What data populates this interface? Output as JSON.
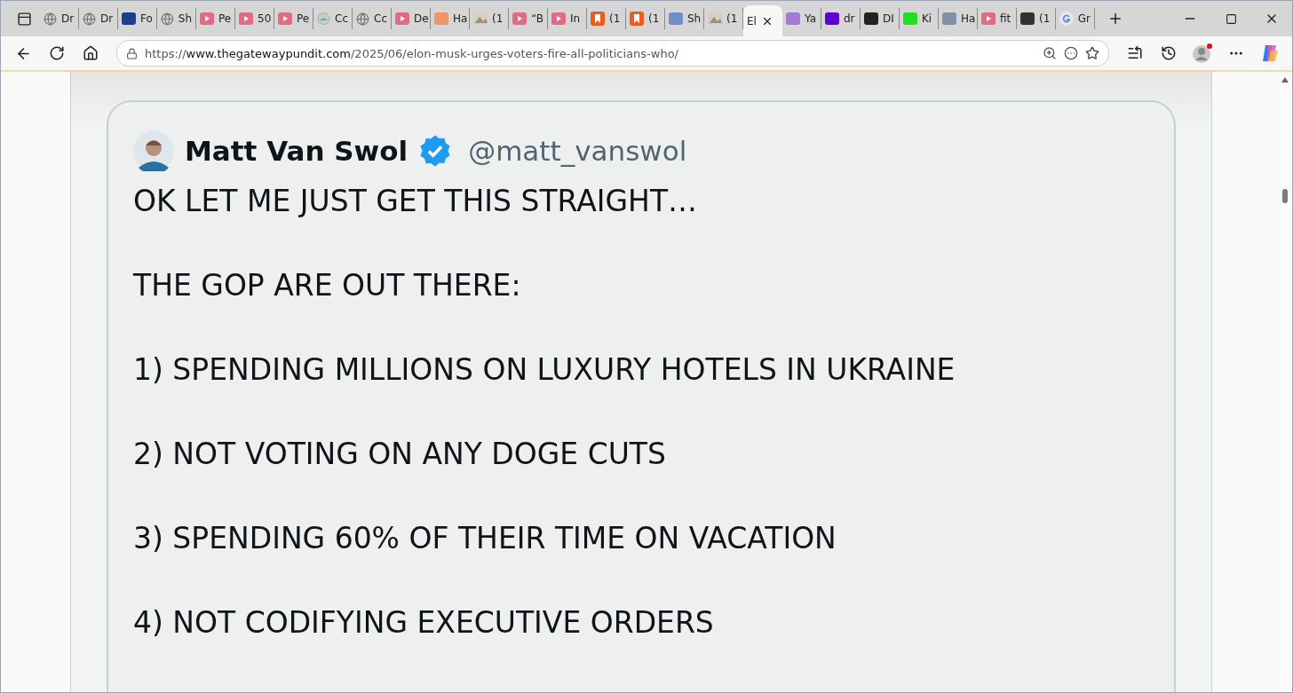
{
  "tabs": [
    {
      "label": "Dr",
      "kind": "globe",
      "selected": false
    },
    {
      "label": "Dr",
      "kind": "globe",
      "selected": false
    },
    {
      "label": "Fo",
      "kind": "logo",
      "color": "#1b3f8f",
      "selected": false
    },
    {
      "label": "Sh",
      "kind": "globe",
      "selected": false
    },
    {
      "label": "Pe",
      "kind": "video",
      "selected": false
    },
    {
      "label": "50",
      "kind": "video",
      "selected": false
    },
    {
      "label": "Pe",
      "kind": "video",
      "selected": false
    },
    {
      "label": "Cc",
      "kind": "seal",
      "selected": false
    },
    {
      "label": "Cc",
      "kind": "globe",
      "selected": false
    },
    {
      "label": "De",
      "kind": "video",
      "selected": false
    },
    {
      "label": "Ha",
      "kind": "logo",
      "color": "#f0946a",
      "selected": false
    },
    {
      "label": "(1",
      "kind": "photo",
      "selected": false
    },
    {
      "label": "“B",
      "kind": "video",
      "selected": false
    },
    {
      "label": "In",
      "kind": "video",
      "selected": false
    },
    {
      "label": "(1",
      "kind": "bookmark",
      "selected": false
    },
    {
      "label": "(1",
      "kind": "bookmark",
      "selected": false
    },
    {
      "label": "Sh",
      "kind": "logo",
      "color": "#6f8fc9",
      "selected": false
    },
    {
      "label": "(1",
      "kind": "photo",
      "selected": false
    },
    {
      "label": "El",
      "kind": "blank",
      "selected": true
    },
    {
      "label": "Ya",
      "kind": "logo",
      "color": "#a57ad6",
      "selected": false
    },
    {
      "label": "dr",
      "kind": "logo",
      "color": "#5f01d1",
      "selected": false
    },
    {
      "label": "DI",
      "kind": "logo",
      "color": "#222222",
      "selected": false
    },
    {
      "label": "Ki",
      "kind": "logo",
      "color": "#22dd22",
      "selected": false
    },
    {
      "label": "Ha",
      "kind": "logo",
      "color": "#8090a8",
      "selected": false
    },
    {
      "label": "fit",
      "kind": "video",
      "selected": false
    },
    {
      "label": "(1",
      "kind": "logo",
      "color": "#333333",
      "selected": false
    },
    {
      "label": "Gr",
      "kind": "google",
      "selected": false
    }
  ],
  "address_bar": {
    "url": "https://**www.thegatewaypundit.com**/2025/06/elon-musk-urges-voters-fire-all-politicians-who/"
  },
  "tweet": {
    "name": "Matt Van Swol",
    "verified": true,
    "handle": "@matt_vanswol",
    "lines": [
      "OK LET ME JUST GET THIS STRAIGHT…",
      "THE GOP ARE OUT THERE:",
      "1) SPENDING MILLIONS ON LUXURY HOTELS IN UKRAINE",
      "2) NOT VOTING ON ANY DOGE CUTS",
      "3) SPENDING 60% OF THEIR TIME ON VACATION",
      "4) NOT CODIFYING EXECUTIVE ORDERS"
    ]
  }
}
